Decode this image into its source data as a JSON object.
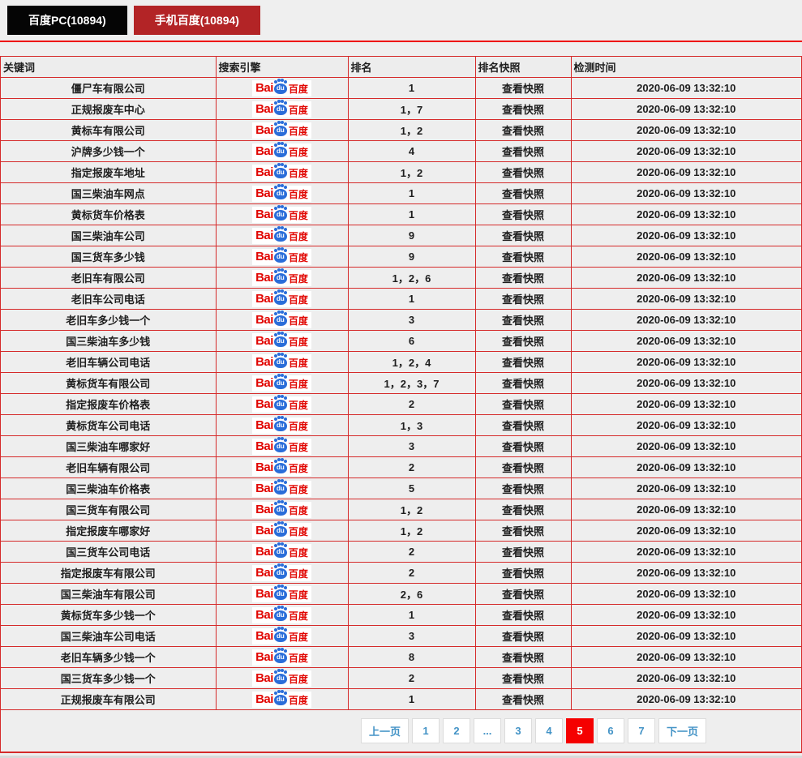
{
  "tabs": [
    {
      "id": "pc",
      "label": "百度PC(10894)"
    },
    {
      "id": "mobile",
      "label": "手机百度(10894)"
    }
  ],
  "colors": {
    "tab_pc_bg": "#050505",
    "tab_mobile_bg": "#b32426",
    "table_border": "#d52a2a",
    "divider": "#ee0b0b",
    "pagination_link": "#4393c6",
    "pagination_active_bg": "#f50000",
    "logo_red": "#e10602",
    "logo_blue": "#2a6dd9"
  },
  "table": {
    "columns": [
      "关键词",
      "搜索引擎",
      "排名",
      "排名快照",
      "检测时间"
    ],
    "engine": {
      "name": "baidu",
      "logo_bai": "Bai",
      "logo_du": "du",
      "logo_cn": "百度"
    },
    "snapshot_label": "查看快照",
    "detect_time": "2020-06-09 13:32:10",
    "rows": [
      {
        "keyword": "僵尸车有限公司",
        "rank": "1"
      },
      {
        "keyword": "正规报废车中心",
        "rank": "1，7"
      },
      {
        "keyword": "黄标车有限公司",
        "rank": "1，2"
      },
      {
        "keyword": "沪牌多少钱一个",
        "rank": "4"
      },
      {
        "keyword": "指定报废车地址",
        "rank": "1，2"
      },
      {
        "keyword": "国三柴油车网点",
        "rank": "1"
      },
      {
        "keyword": "黄标货车价格表",
        "rank": "1"
      },
      {
        "keyword": "国三柴油车公司",
        "rank": "9"
      },
      {
        "keyword": "国三货车多少钱",
        "rank": "9"
      },
      {
        "keyword": "老旧车有限公司",
        "rank": "1，2，6"
      },
      {
        "keyword": "老旧车公司电话",
        "rank": "1"
      },
      {
        "keyword": "老旧车多少钱一个",
        "rank": "3"
      },
      {
        "keyword": "国三柴油车多少钱",
        "rank": "6"
      },
      {
        "keyword": "老旧车辆公司电话",
        "rank": "1，2，4"
      },
      {
        "keyword": "黄标货车有限公司",
        "rank": "1，2，3，7"
      },
      {
        "keyword": "指定报废车价格表",
        "rank": "2"
      },
      {
        "keyword": "黄标货车公司电话",
        "rank": "1，3"
      },
      {
        "keyword": "国三柴油车哪家好",
        "rank": "3"
      },
      {
        "keyword": "老旧车辆有限公司",
        "rank": "2"
      },
      {
        "keyword": "国三柴油车价格表",
        "rank": "5"
      },
      {
        "keyword": "国三货车有限公司",
        "rank": "1，2"
      },
      {
        "keyword": "指定报废车哪家好",
        "rank": "1，2"
      },
      {
        "keyword": "国三货车公司电话",
        "rank": "2"
      },
      {
        "keyword": "指定报废车有限公司",
        "rank": "2"
      },
      {
        "keyword": "国三柴油车有限公司",
        "rank": "2，6"
      },
      {
        "keyword": "黄标货车多少钱一个",
        "rank": "1"
      },
      {
        "keyword": "国三柴油车公司电话",
        "rank": "3"
      },
      {
        "keyword": "老旧车辆多少钱一个",
        "rank": "8"
      },
      {
        "keyword": "国三货车多少钱一个",
        "rank": "2"
      },
      {
        "keyword": "正规报废车有限公司",
        "rank": "1"
      }
    ]
  },
  "pagination": {
    "items": [
      {
        "label": "上一页",
        "type": "prev"
      },
      {
        "label": "1",
        "type": "page"
      },
      {
        "label": "2",
        "type": "page"
      },
      {
        "label": "...",
        "type": "ellipsis"
      },
      {
        "label": "3",
        "type": "page"
      },
      {
        "label": "4",
        "type": "page"
      },
      {
        "label": "5",
        "type": "page",
        "active": true
      },
      {
        "label": "6",
        "type": "page"
      },
      {
        "label": "7",
        "type": "page"
      },
      {
        "label": "下一页",
        "type": "next"
      }
    ]
  }
}
